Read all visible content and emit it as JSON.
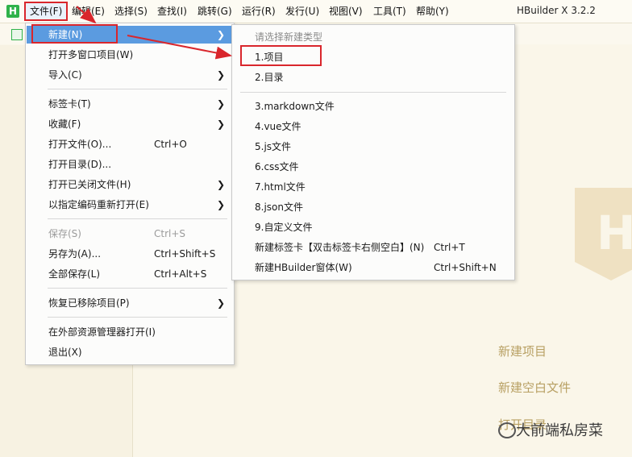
{
  "menubar": {
    "items": [
      {
        "label": "文件(F)"
      },
      {
        "label": "编辑(E)"
      },
      {
        "label": "选择(S)"
      },
      {
        "label": "查找(I)"
      },
      {
        "label": "跳转(G)"
      },
      {
        "label": "运行(R)"
      },
      {
        "label": "发行(U)"
      },
      {
        "label": "视图(V)"
      },
      {
        "label": "工具(T)"
      },
      {
        "label": "帮助(Y)"
      }
    ],
    "app_title": "HBuilder X 3.2.2"
  },
  "file_menu": {
    "new": "新建(N)",
    "open_multi": "打开多窗口项目(W)",
    "import": "导入(C)",
    "tabs": "标签卡(T)",
    "favorites": "收藏(F)",
    "open_file": "打开文件(O)...",
    "open_file_shortcut": "Ctrl+O",
    "open_dir": "打开目录(D)...",
    "open_closed": "打开已关闭文件(H)",
    "reopen_encoding": "以指定编码重新打开(E)",
    "save": "保存(S)",
    "save_shortcut": "Ctrl+S",
    "save_as": "另存为(A)...",
    "save_as_shortcut": "Ctrl+Shift+S",
    "save_all": "全部保存(L)",
    "save_all_shortcut": "Ctrl+Alt+S",
    "restore_removed": "恢复已移除项目(P)",
    "open_in_explorer": "在外部资源管理器打开(I)",
    "exit": "退出(X)"
  },
  "new_submenu": {
    "header": "请选择新建类型",
    "project": "1.项目",
    "directory": "2.目录",
    "markdown": "3.markdown文件",
    "vue": "4.vue文件",
    "js": "5.js文件",
    "css": "6.css文件",
    "html": "7.html文件",
    "json": "8.json文件",
    "custom": "9.自定义文件",
    "new_tab": "新建标签卡【双击标签卡右侧空白】(N)",
    "new_tab_shortcut": "Ctrl+T",
    "new_window": "新建HBuilder窗体(W)",
    "new_window_shortcut": "Ctrl+Shift+N"
  },
  "editor": {
    "new_project": "新建项目",
    "new_blank_file": "新建空白文件",
    "open_dir": "打开目录"
  },
  "watermark": "大前端私房菜",
  "colors": {
    "highlight": "#5b9be0",
    "annotation": "#d9262c",
    "background": "#faf6e9"
  }
}
